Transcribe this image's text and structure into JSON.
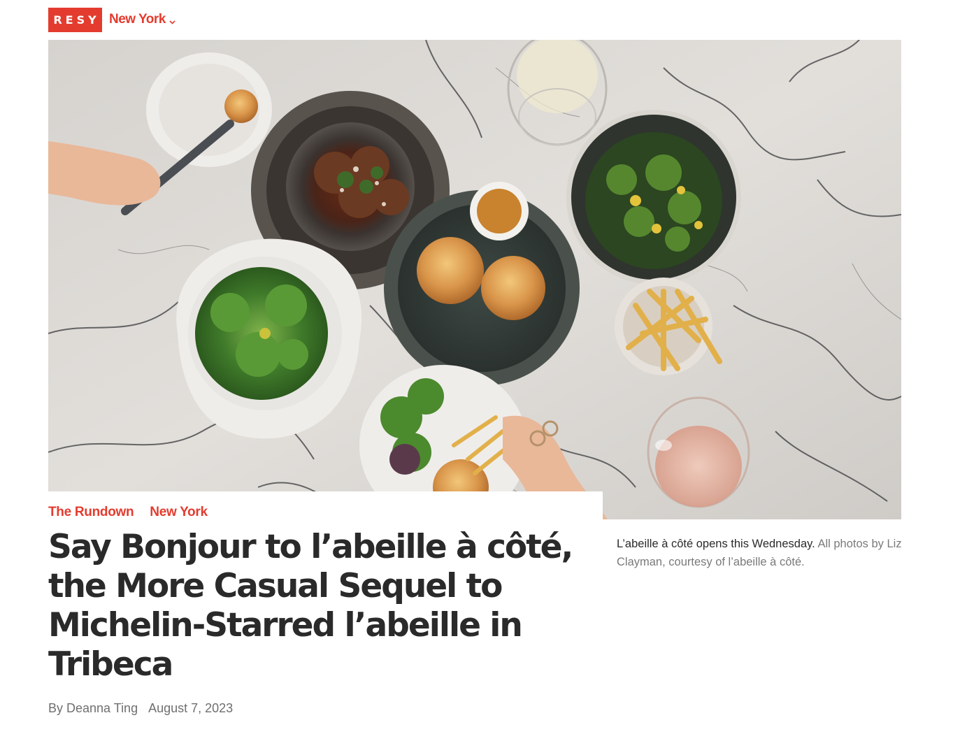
{
  "header": {
    "logo_text": "RESY",
    "city": "New York",
    "city_icon": "chevron-down-icon",
    "brand_color": "#e33c2f"
  },
  "hero": {
    "image_icon": "food-table-photo"
  },
  "article": {
    "tags": [
      "The Rundown",
      "New York"
    ],
    "headline": "Say Bonjour to l’abeille à côté, the More Casual Sequel to Michelin-Starred l’abeille in Tribeca",
    "author": "By Deanna Ting",
    "date": "August 7, 2023"
  },
  "caption": {
    "text": "L’abeille à côté opens this Wednesday.",
    "credit": "All photos by Liz Clayman, courtesy of l’abeille à côté."
  }
}
